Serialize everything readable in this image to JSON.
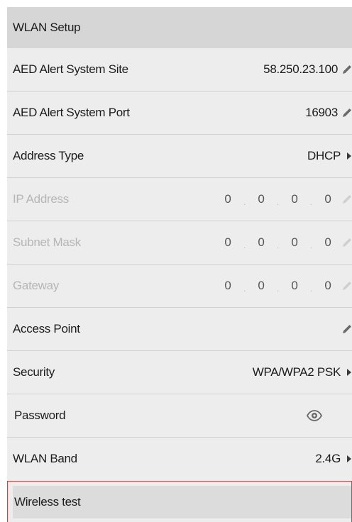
{
  "header": {
    "title": "WLAN Setup"
  },
  "rows": {
    "site": {
      "label": "AED Alert System Site",
      "value": "58.250.23.100"
    },
    "port": {
      "label": "AED Alert System Port",
      "value": "16903"
    },
    "address_type": {
      "label": "Address Type",
      "value": "DHCP"
    },
    "ip": {
      "label": "IP Address",
      "octets": [
        "0",
        "0",
        "0",
        "0"
      ]
    },
    "subnet": {
      "label": "Subnet Mask",
      "octets": [
        "0",
        "0",
        "0",
        "0"
      ]
    },
    "gateway": {
      "label": "Gateway",
      "octets": [
        "0",
        "0",
        "0",
        "0"
      ]
    },
    "access_point": {
      "label": "Access Point",
      "value": ""
    },
    "security": {
      "label": "Security",
      "value": "WPA/WPA2 PSK"
    },
    "password": {
      "label": "Password"
    },
    "band": {
      "label": "WLAN Band",
      "value": "2.4G"
    }
  },
  "wireless_test": {
    "label": "Wireless test"
  },
  "ip_separator": ".",
  "icons": {
    "edit": "pencil-icon",
    "submenu": "arrow-right-icon",
    "show_password": "eye-icon"
  },
  "colors": {
    "header_bg": "#d6d6d6",
    "row_bg": "#ededed",
    "disabled_text": "#b6b6b6",
    "focus_border": "#d64040"
  }
}
